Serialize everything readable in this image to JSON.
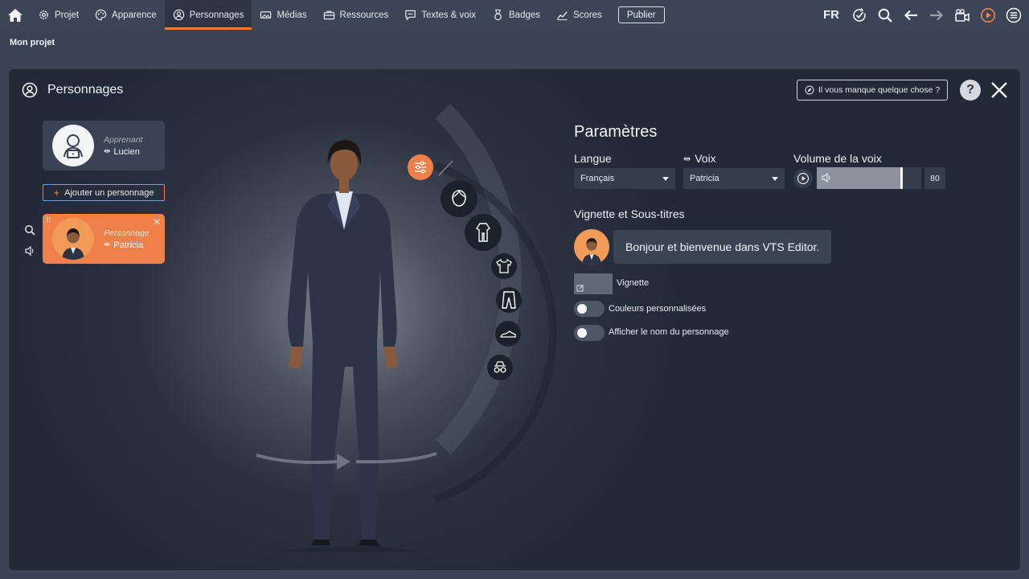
{
  "nav": {
    "items": [
      {
        "label": "Projet",
        "icon": "gear-icon"
      },
      {
        "label": "Apparence",
        "icon": "palette-icon"
      },
      {
        "label": "Personnages",
        "icon": "user-circle-icon"
      },
      {
        "label": "Médias",
        "icon": "media-icon"
      },
      {
        "label": "Ressources",
        "icon": "briefcase-icon"
      },
      {
        "label": "Textes & voix",
        "icon": "speech-icon"
      },
      {
        "label": "Badges",
        "icon": "badge-icon"
      },
      {
        "label": "Scores",
        "icon": "chart-icon"
      }
    ],
    "active": "Personnages",
    "publish_label": "Publier",
    "language": "FR"
  },
  "project": {
    "name": "Mon projet"
  },
  "panel": {
    "title": "Personnages",
    "missing_label": "Il vous manque quelque chose ?",
    "help_label": "?"
  },
  "characters": {
    "learner": {
      "role": "Apprenant",
      "name": "Lucien"
    },
    "add_label": "Ajouter un personnage",
    "selected": {
      "role": "Personnage",
      "name": "Patricia"
    }
  },
  "settings": {
    "title": "Paramètres",
    "language_label": "Langue",
    "language_value": "Français",
    "voice_label": "Voix",
    "voice_value": "Patricia",
    "volume_label": "Volume de la voix",
    "volume_value": "80",
    "volume_fraction": 0.8,
    "subtitles_title": "Vignette et Sous-titres",
    "preview_text": "Bonjour et bienvenue dans VTS Editor.",
    "vignette_label": "Vignette",
    "custom_colors_label": "Couleurs personnalisées",
    "show_name_label": "Afficher le nom du personnage"
  },
  "colors": {
    "accent": "#f0804a",
    "background": "#3a4455",
    "panel": "#222a38"
  }
}
